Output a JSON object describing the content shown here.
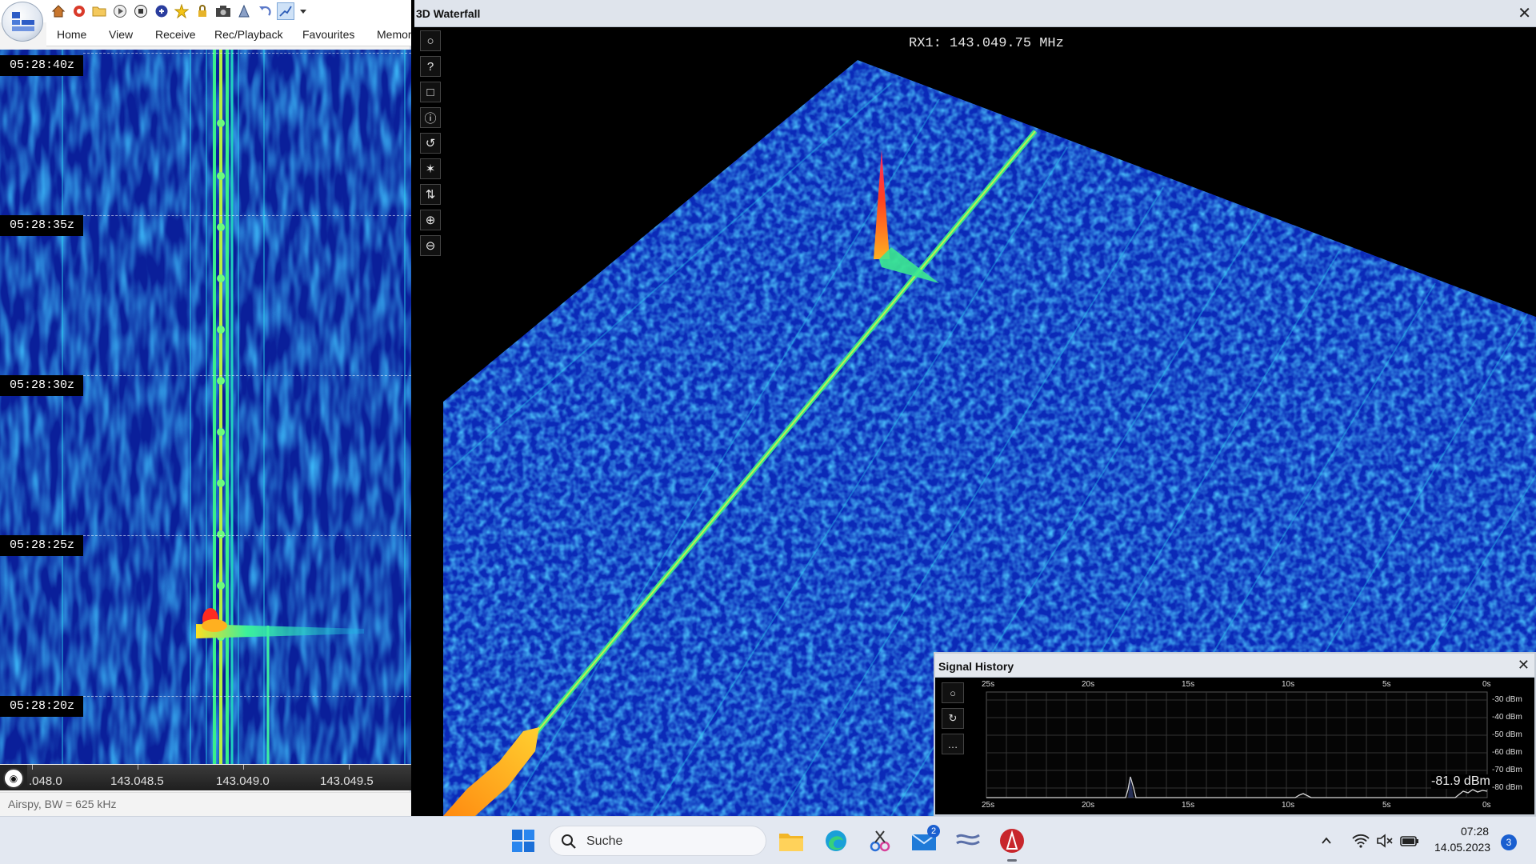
{
  "left_pane": {
    "ribbon_tabs": [
      "Home",
      "View",
      "Receive",
      "Rec/Playback",
      "Favourites",
      "Memor"
    ],
    "time_labels": [
      "05:28:40z",
      "05:28:35z",
      "05:28:30z",
      "05:28:25z",
      "05:28:20z"
    ],
    "freq_labels": [
      ".048.0",
      "143.048.5",
      "143.049.0",
      "143.049.5"
    ],
    "status": "Airspy, BW = 625 kHz"
  },
  "waterfall3d": {
    "title": "3D Waterfall",
    "close": "✕",
    "rx_label": "RX1: 143.049.75 MHz",
    "tools": [
      "○",
      "?",
      "□",
      "ⓘ",
      "↺",
      "✶",
      "⇅",
      "⊕",
      "⊖"
    ]
  },
  "signal_history": {
    "title": "Signal History",
    "close": "✕",
    "tools": [
      "○",
      "↻",
      "…"
    ],
    "x_labels": [
      "25s",
      "20s",
      "15s",
      "10s",
      "5s",
      "0s"
    ],
    "y_labels": [
      "-30 dBm",
      "-40 dBm",
      "-50 dBm",
      "-60 dBm",
      "-70 dBm",
      "-80 dBm"
    ],
    "current_value": "-81.9 dBm"
  },
  "taskbar": {
    "search_placeholder": "Suche",
    "time": "07:28",
    "date": "14.05.2023",
    "mail_badge": "2",
    "notification_badge": "3"
  },
  "colors": {
    "waterfall_blue": "#0a2fb8",
    "signal_green": "#2cf08a",
    "peak_red": "#ff2020",
    "accent": "#1a5fd0"
  }
}
